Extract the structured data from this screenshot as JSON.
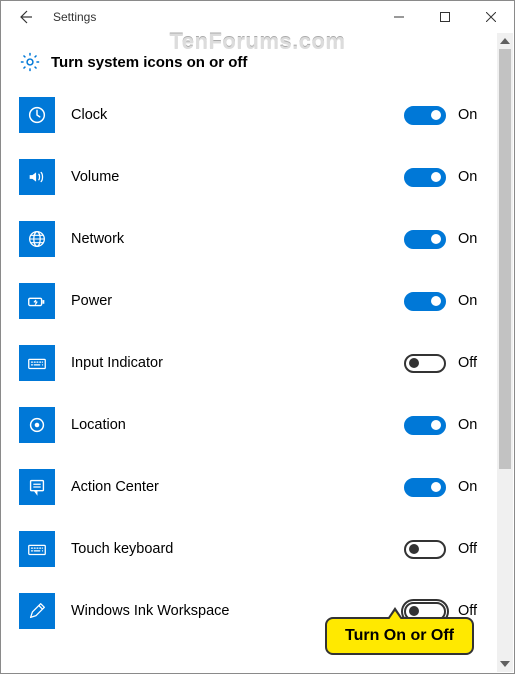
{
  "window": {
    "title": "Settings"
  },
  "watermark": "TenForums.com",
  "page": {
    "heading": "Turn system icons on or off"
  },
  "toggle_labels": {
    "on": "On",
    "off": "Off"
  },
  "settings": [
    {
      "icon": "clock",
      "label": "Clock",
      "on": true
    },
    {
      "icon": "volume",
      "label": "Volume",
      "on": true
    },
    {
      "icon": "network",
      "label": "Network",
      "on": true
    },
    {
      "icon": "power",
      "label": "Power",
      "on": true
    },
    {
      "icon": "keyboard",
      "label": "Input Indicator",
      "on": false
    },
    {
      "icon": "location",
      "label": "Location",
      "on": true
    },
    {
      "icon": "action-center",
      "label": "Action Center",
      "on": true
    },
    {
      "icon": "keyboard",
      "label": "Touch keyboard",
      "on": false
    },
    {
      "icon": "pen",
      "label": "Windows Ink Workspace",
      "on": false,
      "highlight": true
    }
  ],
  "callout": {
    "text": "Turn On or Off"
  }
}
